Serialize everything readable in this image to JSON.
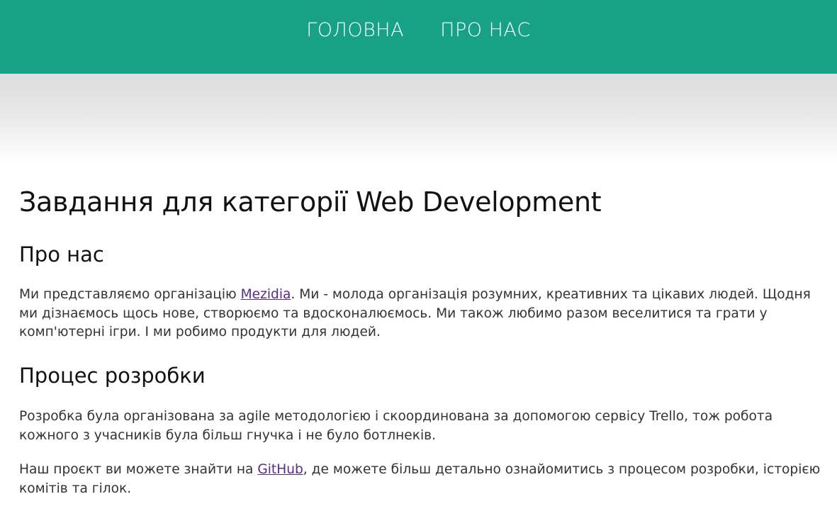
{
  "nav": {
    "items": [
      {
        "label": "ГОЛОВНА"
      },
      {
        "label": "ПРО НАС"
      }
    ]
  },
  "colors": {
    "nav_bg": "#17a287",
    "link": "#5b2a86"
  },
  "main": {
    "title": "Завдання для категорії Web Development",
    "about": {
      "heading": "Про нас",
      "text_before": "Ми представляємо організацію ",
      "link_label": "Mezidia",
      "text_after": ". Ми - молода організація розумних, креативних та цікавих людей. Щодня ми дізнаємось щось нове, створюємо та вдосконалюємось. Ми також любимо разом веселитися та грати у комп'ютерні ігри. І ми робимо продукти для людей."
    },
    "process": {
      "heading": "Процес розробки",
      "text": "Розробка була організована за agile методологією і скоординована за допомогою сервісу Trello, тож робота кожного з учасників була більш гнучка і не було ботлнеків.",
      "github_before": "Наш проєкт ви можете знайти на ",
      "github_link_label": "GitHub",
      "github_after": ", де можете більш детально ознайомитись з процесом розробки, історією комітів та гілок."
    }
  }
}
